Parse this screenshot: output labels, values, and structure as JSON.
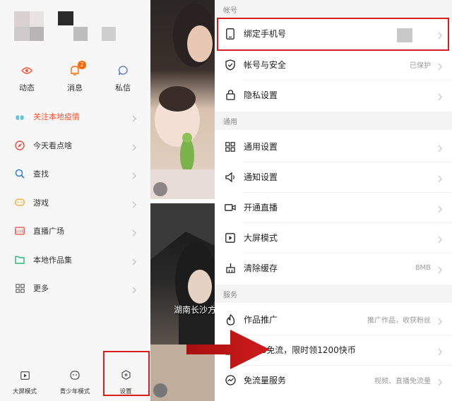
{
  "left": {
    "quick_actions": [
      {
        "label": "动态",
        "icon": "eye-icon"
      },
      {
        "label": "消息",
        "icon": "bell-icon",
        "badge": "2"
      },
      {
        "label": "私信",
        "icon": "chat-bubble-icon"
      }
    ],
    "menu": [
      {
        "label": "关注本地疫情",
        "icon": "lungs-icon",
        "hot": true
      },
      {
        "label": "今天看点啥",
        "icon": "compass-icon"
      },
      {
        "label": "查找",
        "icon": "search-icon"
      },
      {
        "label": "游戏",
        "icon": "gamepad-icon"
      },
      {
        "label": "直播广场",
        "icon": "live-icon"
      },
      {
        "label": "本地作品集",
        "icon": "folder-icon"
      },
      {
        "label": "更多",
        "icon": "grid-icon"
      }
    ],
    "bottom": [
      {
        "label": "大屏模式",
        "icon": "play-box-icon"
      },
      {
        "label": "青少年模式",
        "icon": "youth-mode-icon"
      },
      {
        "label": "设置",
        "icon": "settings-hex-icon"
      }
    ]
  },
  "feed": {
    "caption": "湖南长沙方"
  },
  "settings": {
    "sections": {
      "account": "帐号",
      "general": "通用",
      "service": "服务"
    },
    "account_rows": [
      {
        "label": "绑定手机号",
        "icon": "phone-icon",
        "value": ""
      },
      {
        "label": "帐号与安全",
        "icon": "shield-icon",
        "value": "已保护"
      },
      {
        "label": "隐私设置",
        "icon": "lock-icon",
        "value": ""
      }
    ],
    "general_rows": [
      {
        "label": "通用设置",
        "icon": "grid-icon",
        "value": ""
      },
      {
        "label": "通知设置",
        "icon": "speaker-icon",
        "value": ""
      },
      {
        "label": "开通直播",
        "icon": "video-camera-icon",
        "value": ""
      },
      {
        "label": "大屏模式",
        "icon": "play-box-icon",
        "value": ""
      },
      {
        "label": "清除缓存",
        "icon": "broom-icon",
        "value": "8MB"
      }
    ],
    "service_rows": [
      {
        "label": "作品推广",
        "icon": "flame-icon",
        "value": "推广作品，收获粉丝"
      },
      {
        "label": "200G免流，限时领1200快币",
        "icon": "gift-icon",
        "value": ""
      },
      {
        "label": "免流量服务",
        "icon": "data-plan-icon",
        "value": "视频、直播免流量"
      }
    ]
  },
  "colors": {
    "accent": "#ff6a00",
    "hot_text": "#ff5533",
    "highlight_box": "#d81e1e",
    "arrow": "#c41414"
  }
}
